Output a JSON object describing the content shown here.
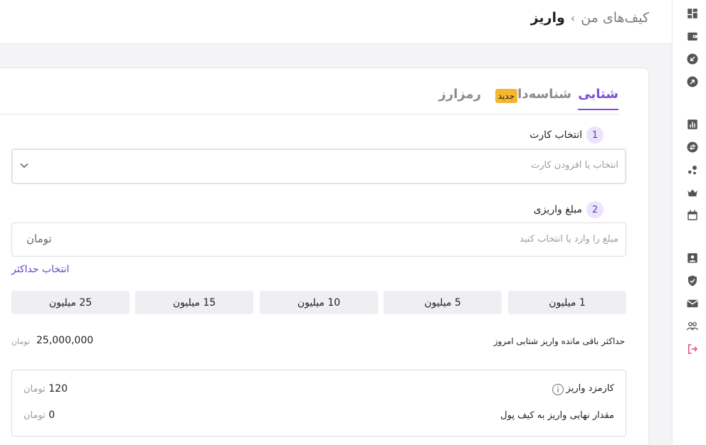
{
  "breadcrumb": {
    "parent": "کیف‌های من",
    "separator": "›",
    "current": "واریز"
  },
  "tabs": [
    {
      "label": "شتابی",
      "active": true
    },
    {
      "label": "شناسه‌دار",
      "badge": "جدید"
    },
    {
      "label": "رمزارز"
    }
  ],
  "step1": {
    "number": "1",
    "label": "انتخاب کارت",
    "placeholder": "انتخاب یا افزودن کارت"
  },
  "step2": {
    "number": "2",
    "label": "مبلغ واریزی",
    "placeholder": "مبلغ را وارد یا انتخاب کنید",
    "unit": "تومان",
    "max_link": "انتخاب حداکثر"
  },
  "chips": [
    "1 میلیون",
    "5 میلیون",
    "10 میلیون",
    "15 میلیون",
    "25 میلیون"
  ],
  "limit": {
    "label": "حداکثر باقی مانده واریز شتابی امروز",
    "value": "25,000,000",
    "unit": "تومان"
  },
  "fee": {
    "label": "کارمزد واریز",
    "value": "120",
    "unit": "تومان"
  },
  "final": {
    "label": "مقدار نهایی واریز به کیف پول",
    "value": "0",
    "unit": "تومان"
  },
  "sidebar_icons": [
    "dashboard-icon",
    "wallet-icon",
    "deposit-icon",
    "withdraw-icon",
    "chart-icon",
    "exchange-icon",
    "bubbles-icon",
    "crown-icon",
    "calendar-icon",
    "profile-icon",
    "shield-check-icon",
    "mail-icon",
    "users-icon",
    "logout-icon"
  ],
  "colors": {
    "accent": "#7c4ddb",
    "badge": "#f5b731",
    "logout": "#e0507a"
  }
}
